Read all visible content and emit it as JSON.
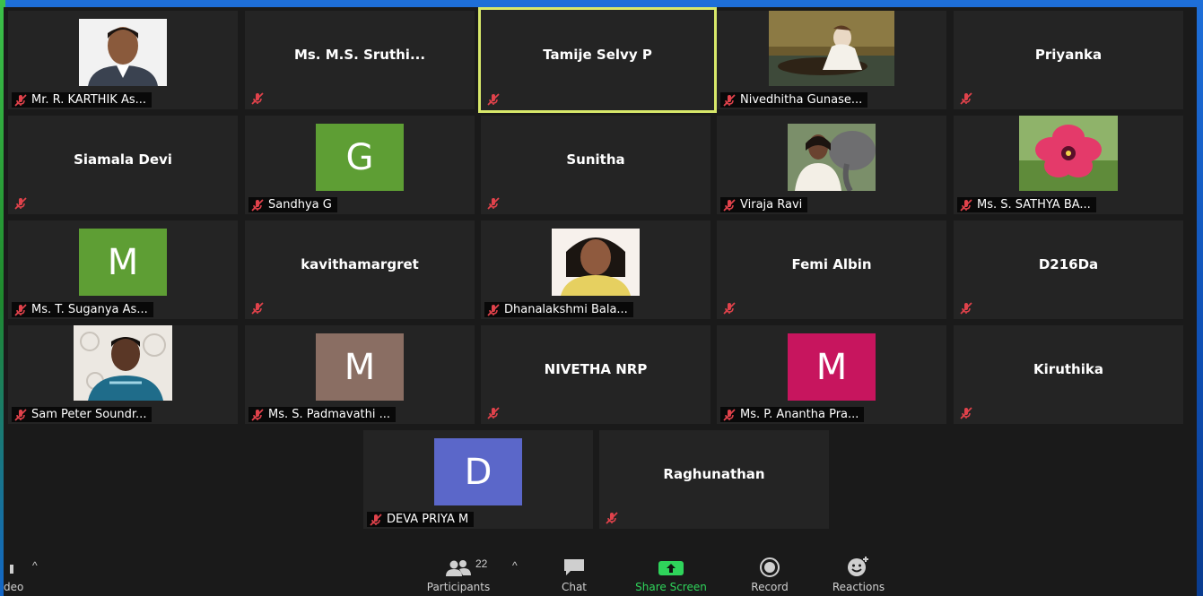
{
  "participants_grid": [
    {
      "name": "Mr. R. KARTHIK As...",
      "display": "photo",
      "photo": "man-portrait"
    },
    {
      "name": "Ms.  M.S.  Sruthi...",
      "display": "name"
    },
    {
      "name": "Tamije Selvy P",
      "display": "name",
      "active_speaker": true
    },
    {
      "name": "Nivedhitha Gunase...",
      "display": "photo",
      "photo": "painting"
    },
    {
      "name": "Priyanka",
      "display": "name"
    },
    {
      "name": "Siamala Devi",
      "display": "name"
    },
    {
      "name": "Sandhya G",
      "display": "letter",
      "letter": "G",
      "color": "#5e9e34"
    },
    {
      "name": "Sunitha",
      "display": "name"
    },
    {
      "name": "Viraja Ravi",
      "display": "photo",
      "photo": "woman-elephant"
    },
    {
      "name": "Ms. S. SATHYA BA...",
      "display": "photo",
      "photo": "flower"
    },
    {
      "name": "Ms. T. Suganya As...",
      "display": "letter",
      "letter": "M",
      "color": "#5e9e34"
    },
    {
      "name": "kavithamargret",
      "display": "name"
    },
    {
      "name": "Dhanalakshmi Bala...",
      "display": "photo",
      "photo": "woman-portrait"
    },
    {
      "name": "Femi Albin",
      "display": "name"
    },
    {
      "name": "D216Da",
      "display": "name"
    },
    {
      "name": "Sam Peter Soundr...",
      "display": "photo",
      "photo": "man-selfie"
    },
    {
      "name": "Ms. S. Padmavathi ...",
      "display": "letter",
      "letter": "M",
      "color": "#8a6e63"
    },
    {
      "name": "NIVETHA NRP",
      "display": "name"
    },
    {
      "name": "Ms. P. Anantha Pra...",
      "display": "letter",
      "letter": "M",
      "color": "#c7155e"
    },
    {
      "name": "Kiruthika",
      "display": "name"
    },
    {
      "name": "DEVA PRIYA M",
      "display": "letter",
      "letter": "D",
      "color": "#5b67c9"
    },
    {
      "name": "Raghunathan",
      "display": "name"
    }
  ],
  "toolbar": {
    "video_label": "deo",
    "participants_label": "Participants",
    "participants_count": "22",
    "chat_label": "Chat",
    "share_label": "Share Screen",
    "record_label": "Record",
    "reactions_label": "Reactions"
  },
  "colors": {
    "muted_icon": "#e0424b",
    "active_border": "#d8e86a",
    "share_green": "#2fd45b"
  }
}
